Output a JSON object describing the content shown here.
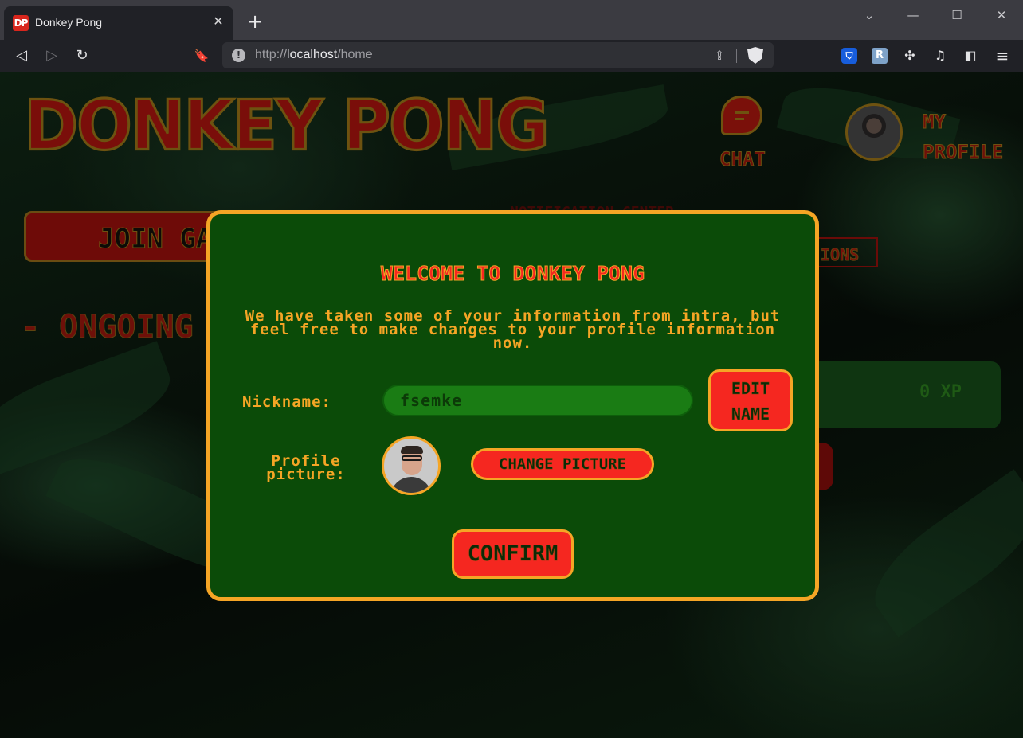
{
  "browser": {
    "tab_title": "Donkey Pong",
    "favicon_text": "DP",
    "url_scheme": "http://",
    "url_host": "localhost",
    "url_path": "/home",
    "icons": {
      "tab_close": "✕",
      "new_tab": "+",
      "back": "◁",
      "forward": "▷",
      "reload": "↻",
      "bookmark": "🔖",
      "info": "!",
      "share": "⇪",
      "minimize": "—",
      "maximize": "☐",
      "close": "✕",
      "tab_search": "⌄",
      "bitwarden": "⛉",
      "ext_r": "R",
      "puzzle": "✣",
      "music": "♫",
      "sidebar": "◧",
      "menu": "≡"
    }
  },
  "page": {
    "logo": "DONKEY PONG",
    "chat_label": "CHAT",
    "profile_label_line1": "MY",
    "profile_label_line2": "PROFILE",
    "join_label": "JOIN GA",
    "notifications_head": "NOTIFICATION CENTER",
    "notifications_tab": "IONS",
    "ongoing_label": "- ONGOING G",
    "xp_label": "0 XP"
  },
  "modal": {
    "title": "WELCOME TO DONKEY PONG",
    "description": "We have taken some of your information from intra, but feel free to make changes to your profile information now.",
    "nickname_label": "Nickname:",
    "nickname_value": "fsemke",
    "edit_button_line1": "EDIT",
    "edit_button_line2": "NAME",
    "picture_label_line1": "Profile",
    "picture_label_line2": "picture:",
    "change_picture_button": "CHANGE PICTURE",
    "confirm_button": "CONFIRM"
  },
  "colors": {
    "modal_bg": "#0b4b08",
    "modal_border": "#f5a525",
    "accent_red": "#f52720",
    "input_green": "#1a7c14"
  }
}
